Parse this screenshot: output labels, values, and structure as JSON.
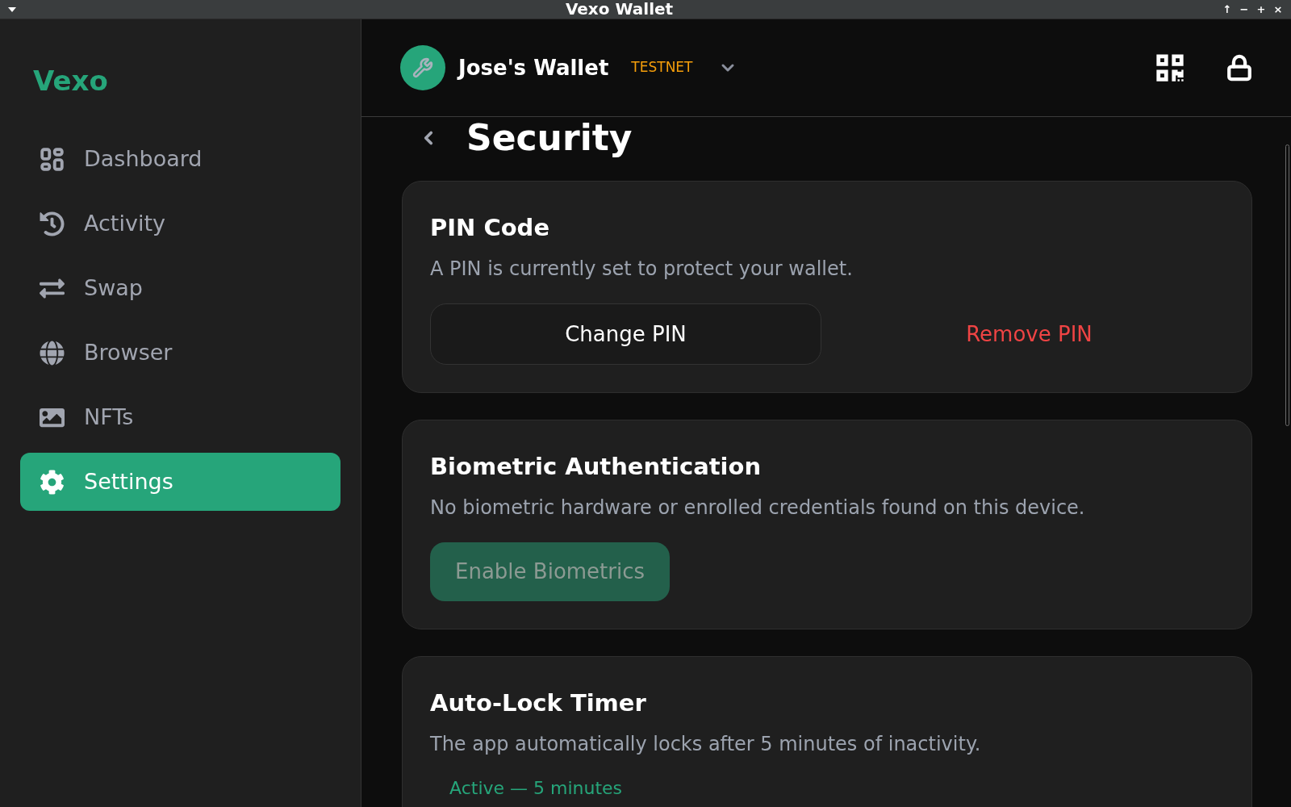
{
  "window": {
    "title": "Vexo Wallet",
    "controls": [
      "↑",
      "−",
      "+",
      "×"
    ]
  },
  "sidebar": {
    "logo": "Vexo",
    "items": [
      {
        "label": "Dashboard",
        "selected": false
      },
      {
        "label": "Activity",
        "selected": false
      },
      {
        "label": "Swap",
        "selected": false
      },
      {
        "label": "Browser",
        "selected": false
      },
      {
        "label": "NFTs",
        "selected": false
      },
      {
        "label": "Settings",
        "selected": true
      }
    ]
  },
  "header": {
    "wallet_name": "Jose's Wallet",
    "network": "TESTNET"
  },
  "page": {
    "title": "Security"
  },
  "cards": [
    {
      "title": "PIN Code",
      "description": "A PIN is currently set to protect your wallet.",
      "actions": [
        {
          "label": "Change PIN",
          "kind": "outline",
          "disabled": false
        },
        {
          "label": "Remove PIN",
          "kind": "danger",
          "disabled": false
        }
      ]
    },
    {
      "title": "Biometric Authentication",
      "description": "No biometric hardware or enrolled credentials found on this device.",
      "actions": [
        {
          "label": "Enable Biometrics",
          "kind": "primary",
          "disabled": true
        }
      ]
    },
    {
      "title": "Auto-Lock Timer",
      "description": "The app automatically locks after 5 minutes of inactivity.",
      "status": "Active — 5 minutes"
    }
  ]
}
